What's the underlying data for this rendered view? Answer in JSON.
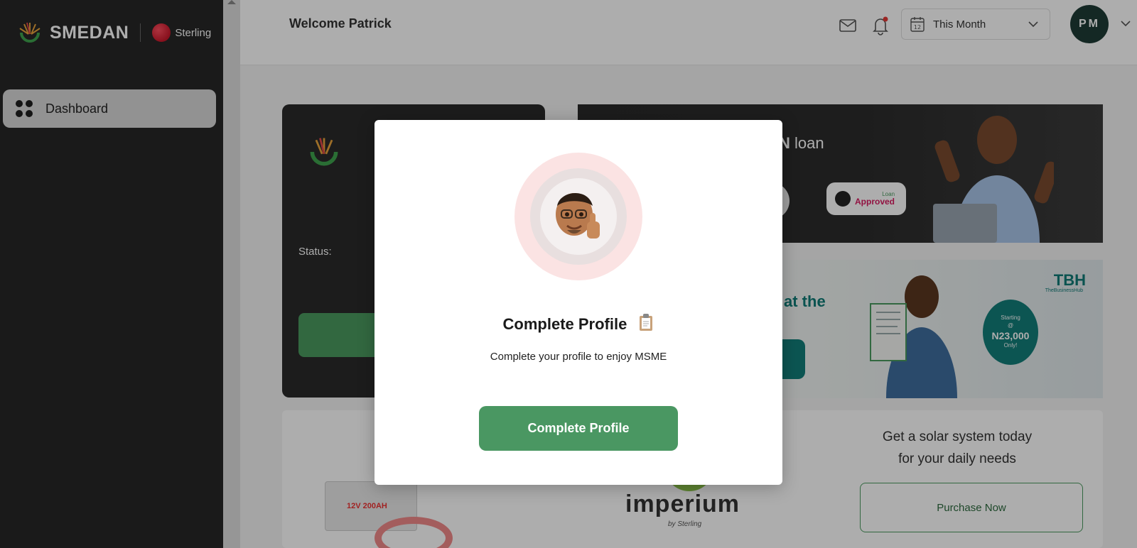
{
  "sidebar": {
    "brand": "SMEDAN",
    "partner": "Sterling",
    "items": [
      {
        "label": "Dashboard"
      }
    ]
  },
  "header": {
    "welcome": "Welcome Patrick",
    "period": "This Month",
    "calendar_day": "12",
    "avatar_initials": "PM"
  },
  "cards": {
    "status_label": "Status:",
    "loan_banner": {
      "text_bold": "N",
      "text_rest": " loan",
      "badge_top": "Loan",
      "badge_text": "Approved"
    },
    "tbh_banner": {
      "text": "at the",
      "logo": "TBH",
      "logo_sub": "TheBusinessHub",
      "price_top": "Starting",
      "price_at": "@",
      "price": "N23,000",
      "price_bottom": "Only!"
    },
    "solar": {
      "battery_label": "12V 200AH",
      "brand": "imperium",
      "brand_by": "by Sterling",
      "title_line1": "Get a solar system today",
      "title_line2": "for your daily needs",
      "cta": "Purchase Now"
    }
  },
  "modal": {
    "title": "Complete Profile",
    "subtitle": "Complete your profile to enjoy MSME",
    "button": "Complete Profile"
  },
  "colors": {
    "sidebar_bg": "#272727",
    "primary_green": "#4a9762",
    "teal": "#137e79",
    "avatar_bg": "#1e3b35",
    "notification_dot": "#e53935"
  },
  "icons": [
    "dashboard-grid-icon",
    "mail-icon",
    "bell-icon",
    "calendar-icon",
    "chevron-down-icon",
    "clipboard-icon"
  ]
}
